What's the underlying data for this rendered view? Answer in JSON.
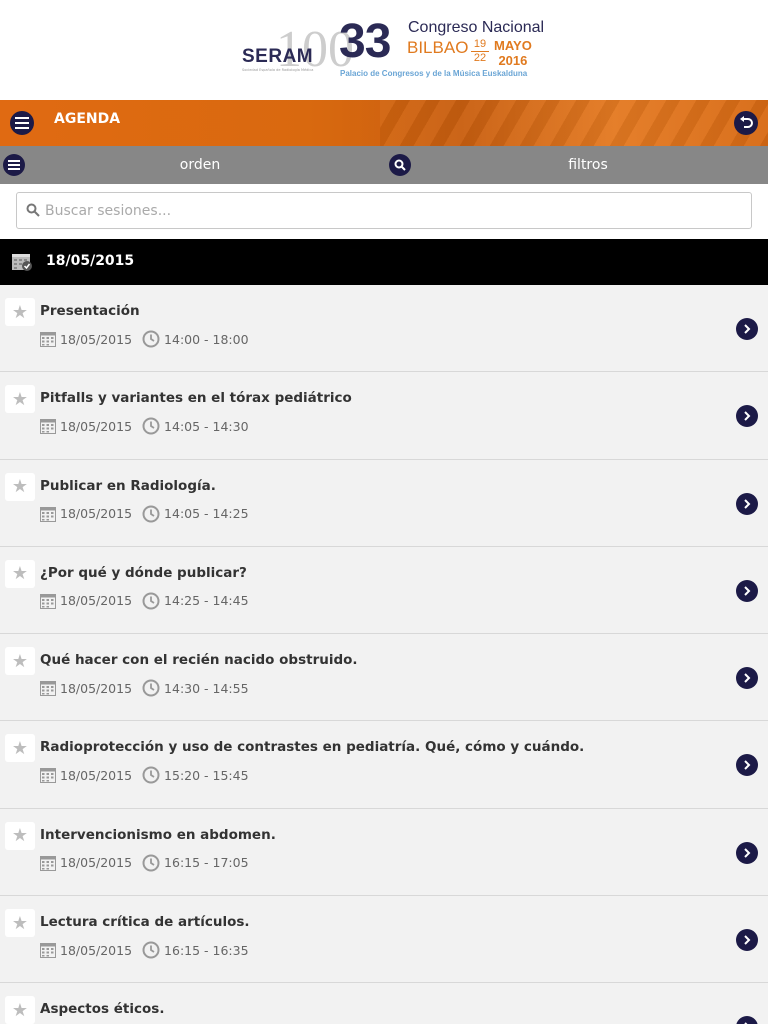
{
  "logo": {
    "org": "SERAM",
    "anniversary": "100",
    "org_subtitle": "Sociedad Española de Radiología Médica",
    "edition": "33",
    "event": "Congreso Nacional",
    "city": "BILBAO",
    "day_start": "19",
    "day_end": "22",
    "month": "MAYO",
    "year": "2016",
    "venue": "Palacio de Congresos y de la Música Euskalduna"
  },
  "header": {
    "title": "AGENDA"
  },
  "toolbar": {
    "order_label": "orden",
    "filters_label": "filtros"
  },
  "search": {
    "placeholder": "Buscar sesiones...",
    "value": ""
  },
  "day": {
    "date": "18/05/2015"
  },
  "sessions": [
    {
      "title": "Presentación",
      "date": "18/05/2015",
      "time": "14:00 - 18:00"
    },
    {
      "title": "Pitfalls y variantes en el tórax pediátrico",
      "date": "18/05/2015",
      "time": "14:05 - 14:30"
    },
    {
      "title": "Publicar en Radiología.",
      "date": "18/05/2015",
      "time": "14:05 - 14:25"
    },
    {
      "title": "¿Por qué y dónde publicar?",
      "date": "18/05/2015",
      "time": "14:25 - 14:45"
    },
    {
      "title": "Qué hacer con el recién nacido obstruido.",
      "date": "18/05/2015",
      "time": "14:30 - 14:55"
    },
    {
      "title": "Radioprotección y uso de contrastes en pediatría. Qué, cómo y cuándo.",
      "date": "18/05/2015",
      "time": "15:20 - 15:45"
    },
    {
      "title": "Intervencionismo en abdomen.",
      "date": "18/05/2015",
      "time": "16:15 - 17:05"
    },
    {
      "title": "Lectura crítica de artículos.",
      "date": "18/05/2015",
      "time": "16:15 - 16:35"
    },
    {
      "title": "Aspectos éticos.",
      "date": "",
      "time": ""
    }
  ],
  "colors": {
    "header_orange": "#e06a12",
    "toolbar_gray": "#878787",
    "button_navy": "#1c1a47",
    "date_bar": "#000000"
  }
}
